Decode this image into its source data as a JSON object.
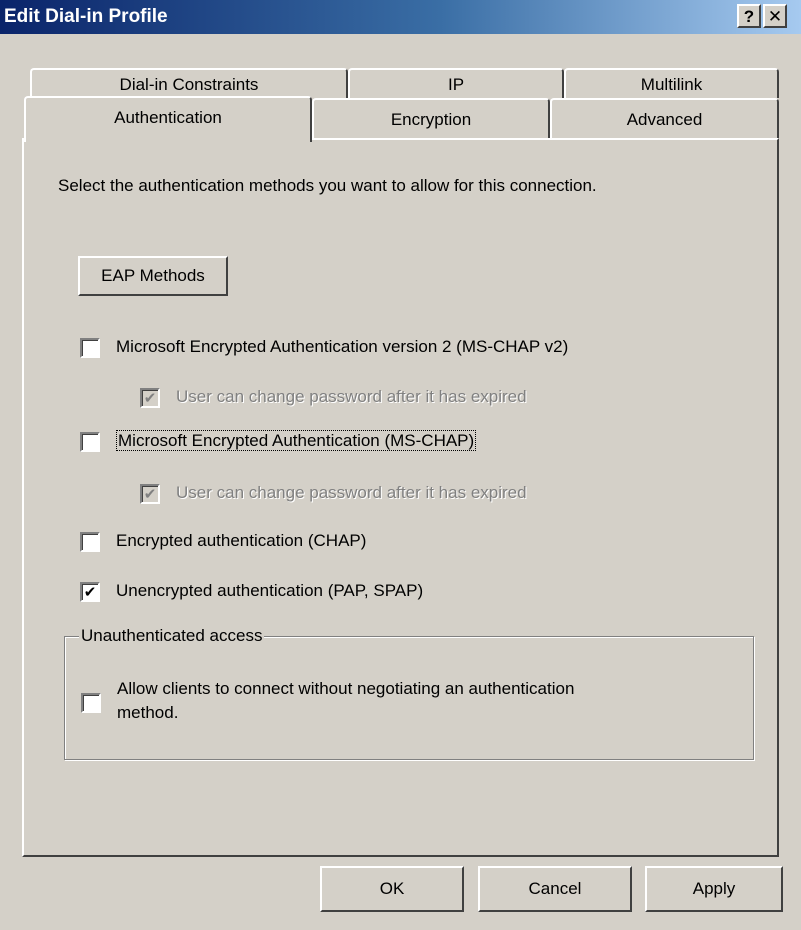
{
  "window": {
    "title": "Edit Dial-in Profile",
    "help_label": "?",
    "close_label": "✕"
  },
  "tabs": {
    "row1": [
      "Dial-in Constraints",
      "IP",
      "Multilink"
    ],
    "row2": [
      "Authentication",
      "Encryption",
      "Advanced"
    ],
    "active": "Authentication"
  },
  "auth": {
    "intro": "Select the authentication methods you want to allow for this connection.",
    "eap_button": "EAP Methods",
    "options": [
      {
        "label": "Microsoft Encrypted Authentication version 2 (MS-CHAP v2)",
        "checked": false
      },
      {
        "label": "User can change password after it has expired",
        "checked": true,
        "disabled": true
      },
      {
        "label": "Microsoft Encrypted Authentication (MS-CHAP)",
        "checked": false
      },
      {
        "label": "User can change password after it has expired",
        "checked": true,
        "disabled": true
      },
      {
        "label": "Encrypted authentication (CHAP)",
        "checked": false
      },
      {
        "label": "Unencrypted authentication (PAP, SPAP)",
        "checked": true
      }
    ],
    "unauth_group": {
      "title": "Unauthenticated access",
      "line1": "Allow clients to connect without negotiating an authentication",
      "line2": "method.",
      "checked": false
    }
  },
  "buttons": {
    "ok": "OK",
    "cancel": "Cancel",
    "apply": "Apply"
  },
  "icons": {
    "check": "✔"
  }
}
